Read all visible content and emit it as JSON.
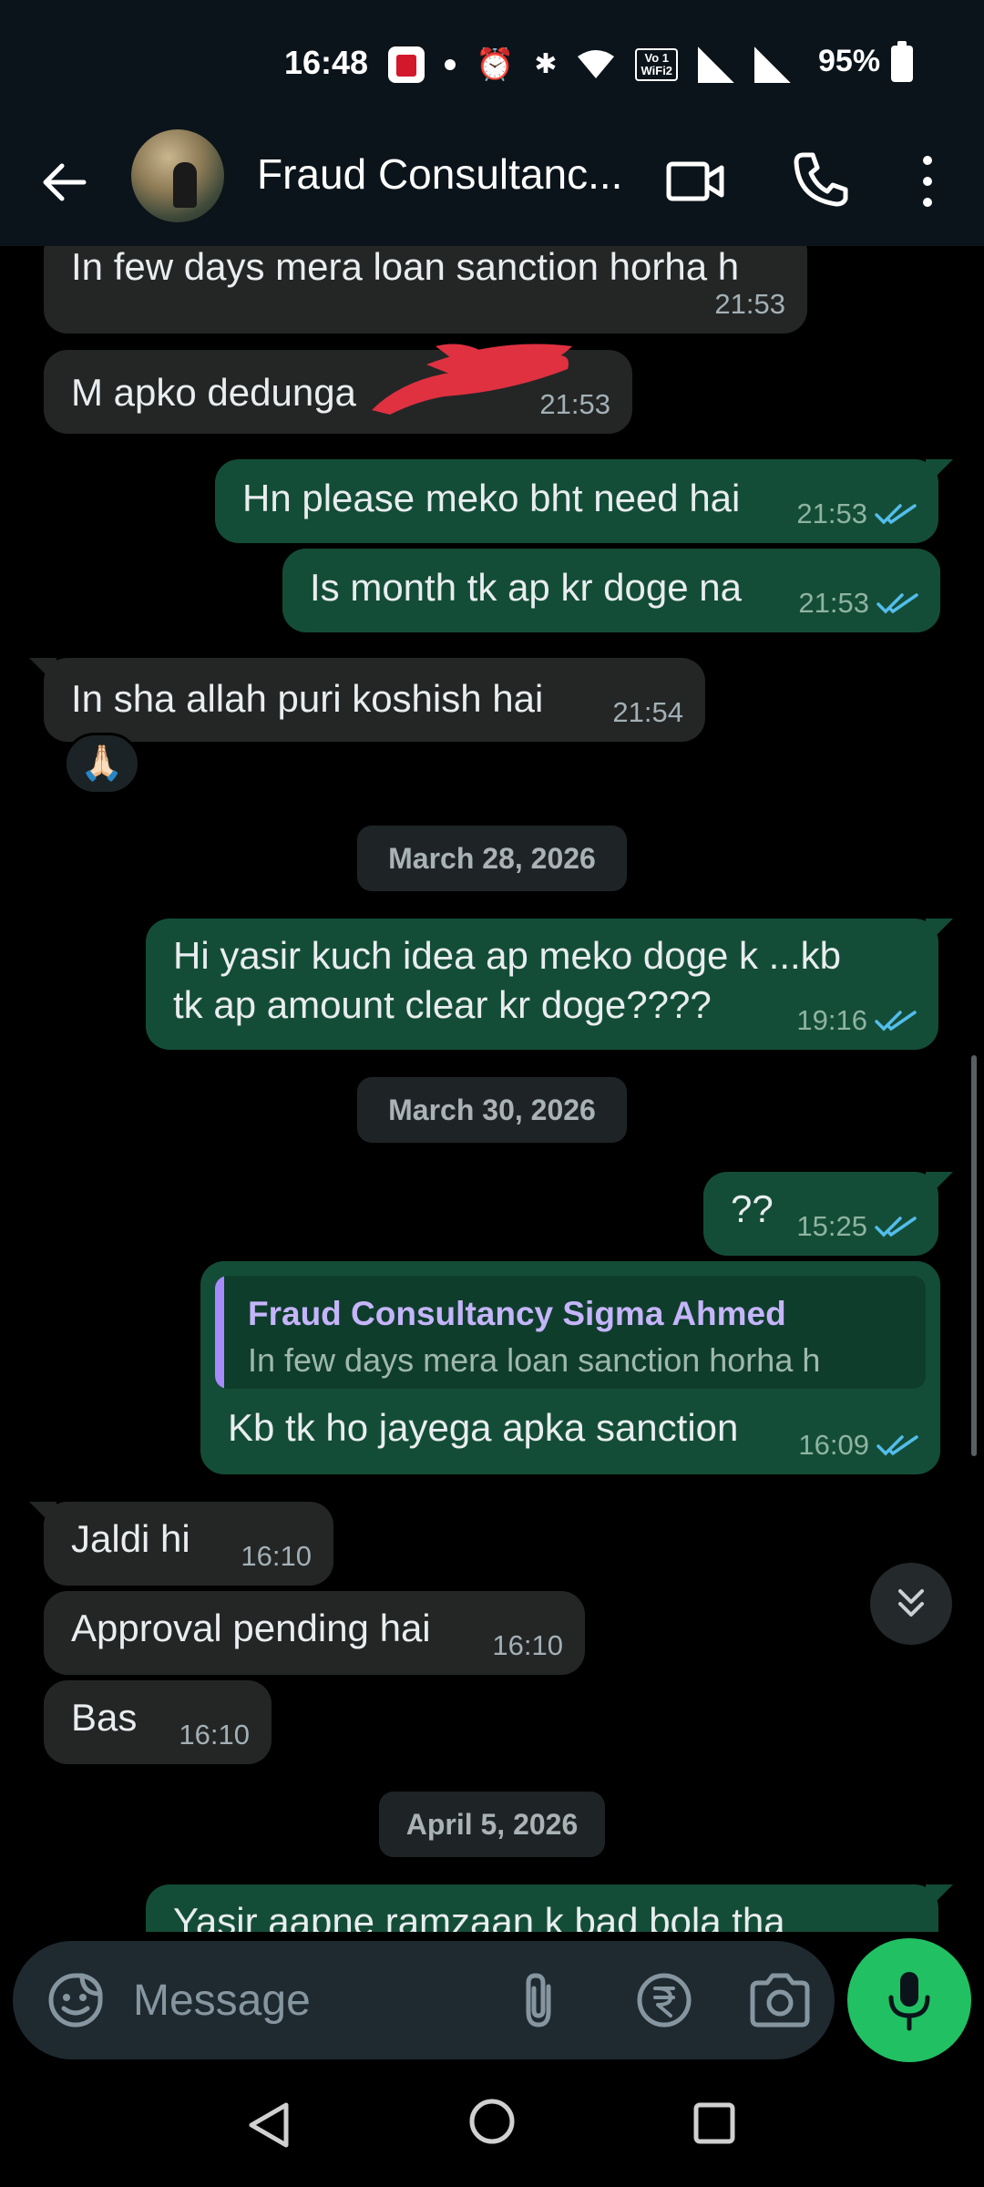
{
  "status_bar": {
    "time": "16:48",
    "battery": "95%",
    "volte_label": "Vo) 1\nWiFi 2"
  },
  "header": {
    "contact_name": "Fraud Consultancy Sigma Ahmed",
    "contact_name_display": "Fraud Consultanc..."
  },
  "messages": [
    {
      "dir": "in",
      "text": "In few days mera loan sanction horha h",
      "time": "21:53"
    },
    {
      "dir": "in",
      "text": "M apko dedunga",
      "time": "21:53",
      "redacted": true
    },
    {
      "dir": "out",
      "text": "Hn please meko bht need hai",
      "time": "21:53",
      "status": "read"
    },
    {
      "dir": "out",
      "text": "Is month tk ap kr doge na",
      "time": "21:53",
      "status": "read"
    },
    {
      "dir": "in",
      "text": "In sha allah puri koshish hai",
      "time": "21:54",
      "reaction": "🙏🏻"
    },
    {
      "date_divider": "March 28, 2026"
    },
    {
      "dir": "out",
      "text": "Hi yasir kuch idea  ap meko doge k ...kb tk ap amount clear kr doge????",
      "line1": "Hi yasir kuch idea  ap meko doge k ...kb",
      "line2": "tk ap amount clear kr doge????",
      "time": "19:16",
      "status": "read"
    },
    {
      "date_divider": "March 30, 2026"
    },
    {
      "dir": "out",
      "text": "??",
      "time": "15:25",
      "status": "read"
    },
    {
      "dir": "out",
      "text": "Kb tk ho jayega apka sanction",
      "time": "16:09",
      "status": "read",
      "reply_to": {
        "name": "Fraud Consultancy Sigma Ahmed",
        "text": "In few days mera loan sanction horha h"
      }
    },
    {
      "dir": "in",
      "text": "Jaldi hi",
      "time": "16:10"
    },
    {
      "dir": "in",
      "text": "Approval pending hai",
      "time": "16:10"
    },
    {
      "dir": "in",
      "text": "Bas",
      "time": "16:10"
    },
    {
      "date_divider": "April 5, 2026"
    },
    {
      "dir": "out",
      "text": "Yasir aapne ramzaan k bad bola tha",
      "partial": true
    }
  ],
  "composer": {
    "placeholder": "Message"
  },
  "colors": {
    "incoming_bubble": "#242626",
    "outgoing_bubble": "#144d37",
    "read_tick": "#53bdeb",
    "mic_button": "#21c063",
    "header_bg": "#0b141a"
  },
  "icons": [
    "back-arrow-icon",
    "video-call-icon",
    "voice-call-icon",
    "more-options-icon",
    "emoji-sticker-icon",
    "attach-icon",
    "rupee-payment-icon",
    "camera-icon",
    "mic-icon",
    "scroll-down-icon"
  ]
}
